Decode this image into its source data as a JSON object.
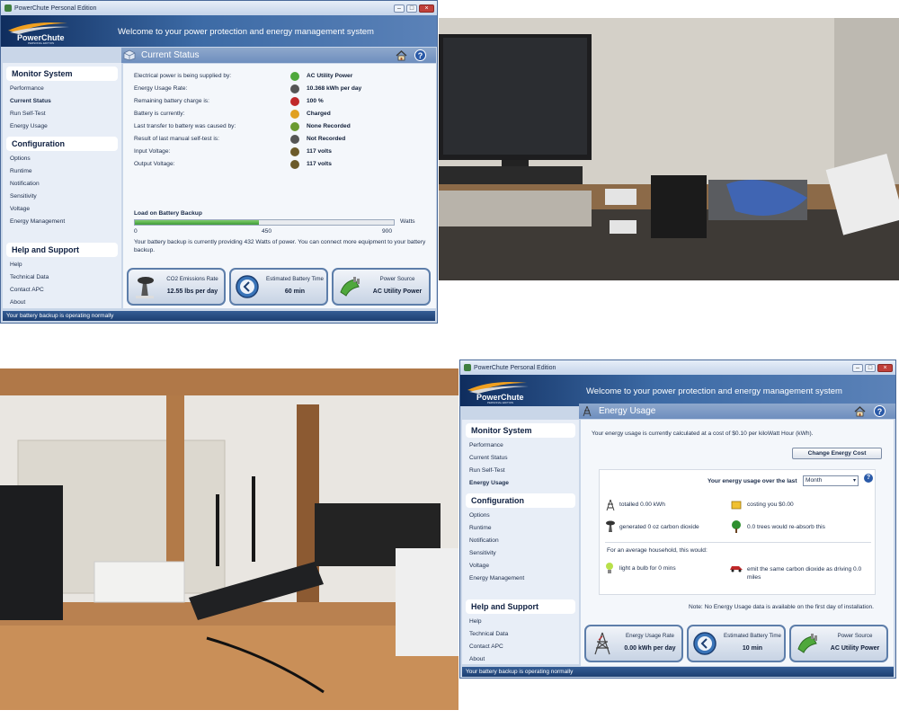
{
  "win1": {
    "title": "PowerChute Personal Edition",
    "welcome": "Welcome to your power protection and energy management system",
    "section": "Current Status",
    "nav": {
      "monitor_heading": "Monitor System",
      "monitor_items": [
        "Performance",
        "Current Status",
        "Run Self-Test",
        "Energy Usage"
      ],
      "config_heading": "Configuration",
      "config_items": [
        "Options",
        "Runtime",
        "Notification",
        "Sensitivity",
        "Voltage",
        "Energy Management"
      ],
      "help_heading": "Help and Support",
      "help_items": [
        "Help",
        "Technical Data",
        "Contact APC",
        "About"
      ]
    },
    "status_rows": [
      {
        "label": "Electrical power is being supplied by:",
        "value": "AC Utility Power",
        "icon": "plug-icon"
      },
      {
        "label": "Energy Usage Rate:",
        "value": "10.368 kWh per day",
        "icon": "tower-icon"
      },
      {
        "label": "Remaining battery charge is:",
        "value": "100 %",
        "icon": "battery-icon"
      },
      {
        "label": "Battery is currently:",
        "value": "Charged",
        "icon": "lightning-icon"
      },
      {
        "label": "Last transfer to battery was caused by:",
        "value": "None Recorded",
        "icon": "transfer-icon"
      },
      {
        "label": "Result of last manual self-test is:",
        "value": "Not Recorded",
        "icon": "stethoscope-icon"
      },
      {
        "label": "Input Voltage:",
        "value": "117 volts",
        "icon": "meter-icon"
      },
      {
        "label": "Output Voltage:",
        "value": "117 volts",
        "icon": "meter-icon"
      }
    ],
    "load": {
      "title": "Load on Battery Backup",
      "unit": "Watts",
      "ticks": [
        "0",
        "450",
        "900"
      ],
      "fraction": 0.48,
      "message": "Your battery backup is currently providing 432 Watts of power. You can connect more equipment to your battery backup."
    },
    "tiles": [
      {
        "label": "CO2 Emissions Rate",
        "value": "12.55 lbs per day",
        "icon": "factory-icon"
      },
      {
        "label": "Estimated Battery Time",
        "value": "60 min",
        "icon": "clock-icon"
      },
      {
        "label": "Power Source",
        "value": "AC Utility Power",
        "icon": "plug-icon"
      }
    ],
    "statusbar": "Your battery backup is operating normally"
  },
  "win2": {
    "title": "PowerChute Personal Edition",
    "welcome": "Welcome to your power protection and energy management system",
    "section": "Energy Usage",
    "nav": {
      "monitor_heading": "Monitor System",
      "monitor_items": [
        "Performance",
        "Current Status",
        "Run Self-Test",
        "Energy Usage"
      ],
      "config_heading": "Configuration",
      "config_items": [
        "Options",
        "Runtime",
        "Notification",
        "Sensitivity",
        "Voltage",
        "Energy Management"
      ],
      "help_heading": "Help and Support",
      "help_items": [
        "Help",
        "Technical Data",
        "Contact APC",
        "About"
      ]
    },
    "cost_text": "Your energy usage is currently calculated at a cost of $0.10 per kiloWatt Hour (kWh).",
    "change_button": "Change Energy Cost",
    "period_label": "Your energy usage over the last",
    "period_value": "Month",
    "totalled": "totalled 0.00 kWh",
    "costing": "costing you  $0.00",
    "generated": "generated 0 oz carbon dioxide",
    "trees": "0.0 trees would re-absorb this",
    "household_heading": "For an average household, this would:",
    "bulb": "light a bulb for 0 mins",
    "car": "emit the same carbon dioxide as driving 0.0 miles",
    "note": "Note: No Energy Usage data is available on the first day of installation.",
    "tiles": [
      {
        "label": "Energy Usage Rate",
        "value": "0.00 kWh per day",
        "icon": "tower-icon"
      },
      {
        "label": "Estimated Battery Time",
        "value": "10 min",
        "icon": "clock-icon"
      },
      {
        "label": "Power Source",
        "value": "AC Utility Power",
        "icon": "plug-icon"
      }
    ],
    "statusbar": "Your battery backup is operating normally"
  },
  "logo_text": "PowerChute",
  "logo_sub": "PERSONAL EDITION",
  "colors": {
    "accent": "#2a5aa8",
    "header_dark": "#0f2d5e",
    "progress": "#3f9a3a"
  }
}
